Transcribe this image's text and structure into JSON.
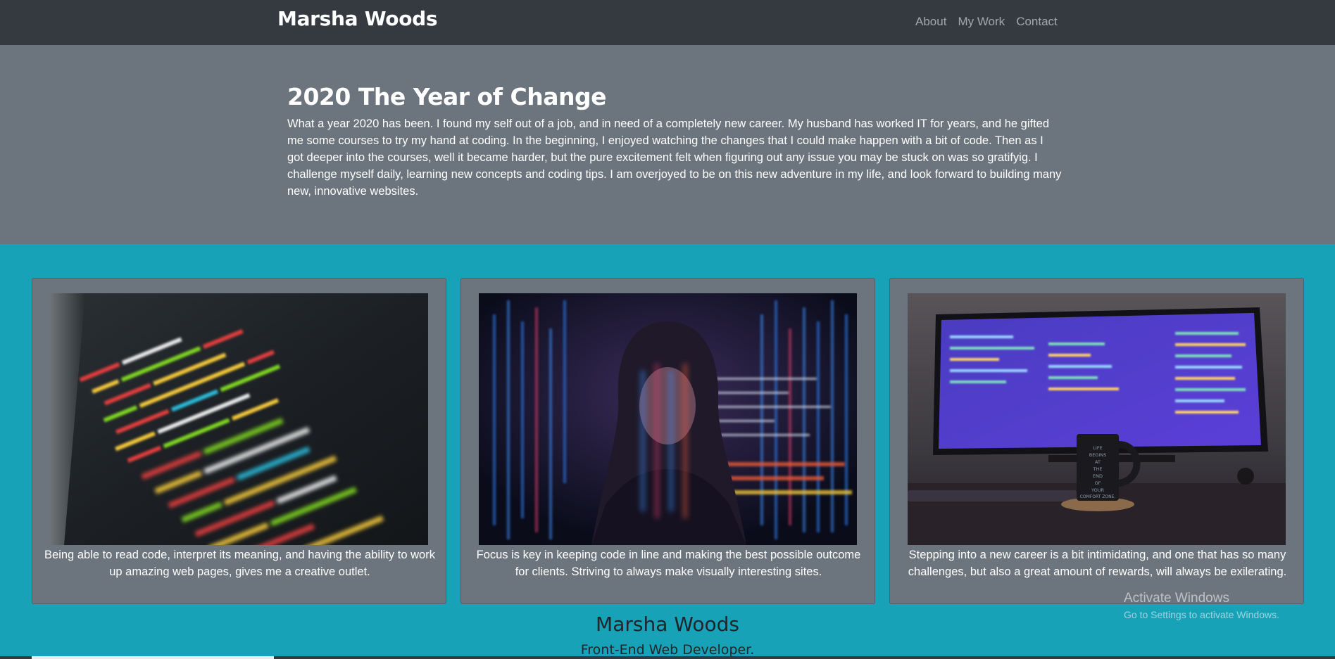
{
  "navbar": {
    "brand": "Marsha Woods",
    "links": [
      "About",
      "My Work",
      "Contact"
    ]
  },
  "hero": {
    "title": "2020 The Year of Change",
    "text": "What a year 2020 has been. I found my self out of a job, and in need of a completely new career. My husband has worked IT for years, and he gifted me some courses to try my hand at coding. In the beginning, I enjoyed watching the changes that I could make happen with a bit of code. Then as I got deeper into the courses, well it became harder, but the pure excitement felt when figuring out any issue you may be stuck on was so gratifyig. I challenge myself daily, learning new concepts and coding tips. I am overjoyed to be on this new adventure in my life, and look forward to building many new, innovative websites."
  },
  "cards": [
    {
      "caption": "Being able to read code, interpret its meaning, and having the ability to work up amazing web pages, gives me a creative outlet."
    },
    {
      "caption": "Focus is key in keeping code in line and making the best possible outcome for clients. Striving to always make visually interesting sites."
    },
    {
      "caption": "Stepping into a new career is a bit intimidating, and one that has so many challenges, but also a great amount of rewards, will always be exilerating."
    }
  ],
  "mug_text": "LIFE BEGINS AT THE END OF YOUR COMFORT ZONE.",
  "footer": {
    "name": "Marsha Woods",
    "role": "Front-End Web Developer."
  },
  "watermark": {
    "title": "Activate Windows",
    "subtitle": "Go to Settings to activate Windows."
  }
}
